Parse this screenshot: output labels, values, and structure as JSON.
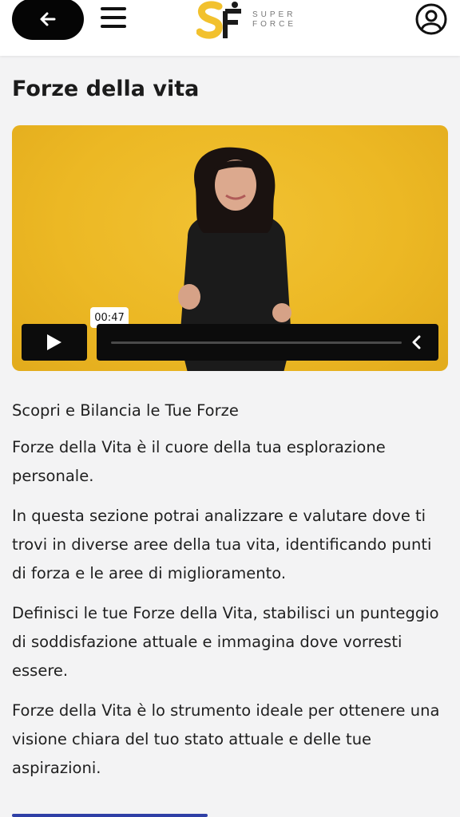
{
  "header": {
    "logo_text_line1": "SUPER",
    "logo_text_line2": "FORCE",
    "colors": {
      "logo_gold": "#f2c12e",
      "logo_dark": "#1a1a1a"
    }
  },
  "page": {
    "title": "Forze della vita"
  },
  "video": {
    "time_tooltip": "00:47",
    "background_color": "#ecb824",
    "progress_fraction": 0.0
  },
  "content": {
    "subtitle": "Scopri e Bilancia le Tue Forze",
    "paragraphs": [
      "Forze della Vita è il cuore della tua esplorazione personale.",
      "In questa sezione potrai analizzare e valutare dove ti trovi in diverse aree della tua vita, identificando punti di forza e le aree di miglioramento.",
      "Definisci le tue Forze della Vita, stabilisci un punteggio di soddisfazione attuale e immagina dove vorresti essere.",
      "Forze della Vita è lo strumento ideale per ottenere una visione chiara del tuo stato attuale e delle tue aspirazioni."
    ]
  },
  "icons": {
    "back": "arrow-left-icon",
    "menu": "hamburger-menu-icon",
    "profile": "user-circle-icon",
    "play": "play-icon",
    "collapse": "chevron-left-icon"
  }
}
